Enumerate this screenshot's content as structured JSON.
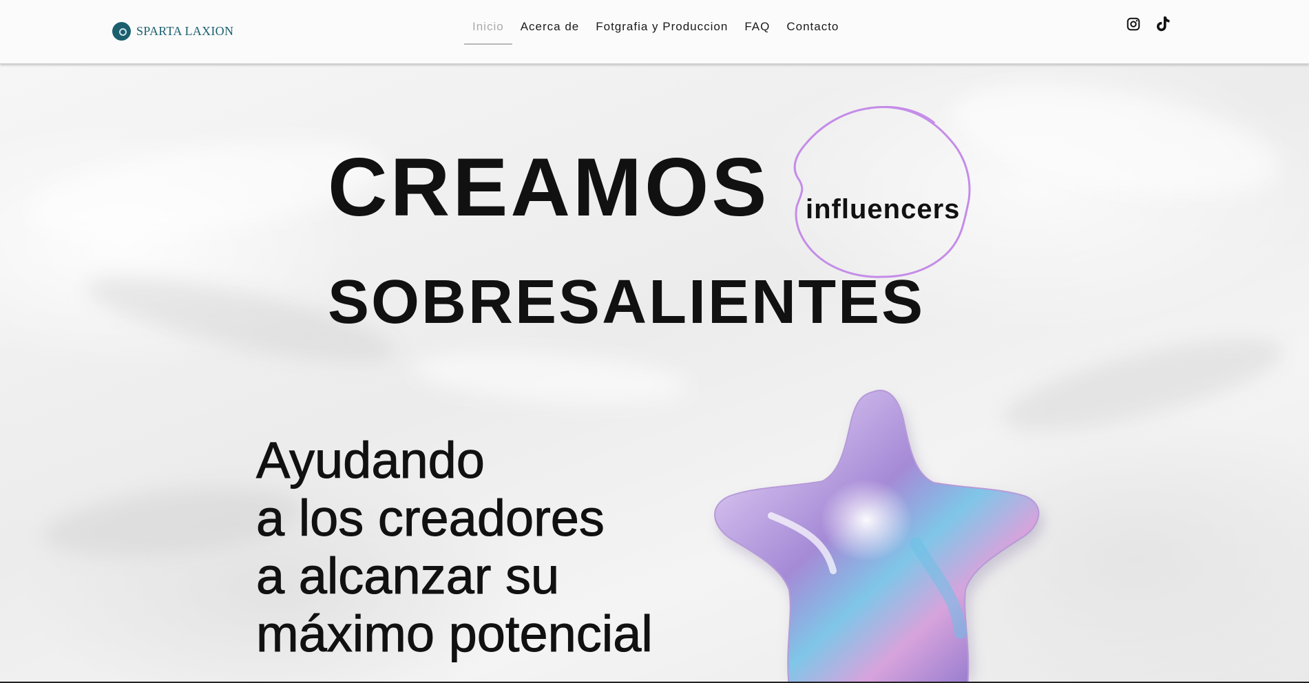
{
  "header": {
    "logo_text": "SPARTA LAXION",
    "nav": [
      {
        "label": "Inicio",
        "active": true
      },
      {
        "label": "Acerca de",
        "active": false
      },
      {
        "label": "Fotgrafia y Produccion",
        "active": false
      },
      {
        "label": "FAQ",
        "active": false
      },
      {
        "label": "Contacto",
        "active": false
      }
    ],
    "social_icons": [
      "instagram-icon",
      "tiktok-icon"
    ]
  },
  "hero": {
    "headline_line1": "CREAMOS",
    "headline_circled": "influencers",
    "headline_line2": "SOBRESALIENTES",
    "tagline": [
      "Ayudando",
      "a los creadores",
      "a alcanzar su",
      "máximo potencial"
    ]
  },
  "colors": {
    "brand": "#1b5f6e",
    "text": "#111111",
    "nav_active": "#aaaaaa",
    "scribble": "#c48ce8"
  }
}
